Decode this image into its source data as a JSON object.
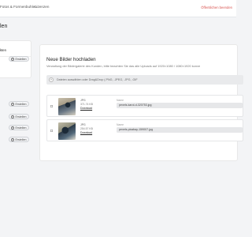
{
  "topbar": {
    "nav": [
      "Fotos & Formenbuhlen",
      "Lizenzen"
    ],
    "end_edit": "Öffentlichen beenden"
  },
  "page": {
    "title": "len"
  },
  "left_panel": {
    "heading": "kten",
    "buttons": [
      "Erstellen",
      "Erstellen",
      "Erstellen",
      "Erstellen",
      "Erstellen"
    ]
  },
  "main": {
    "title": "Neue Bilder hochladen",
    "subtitle": "Verwaltung der Bildergalerie des Kunden, bitte beachten Sie das alle Uploads auf 1920×1080 / 1080×1920 konve",
    "dropzone": {
      "icon": "plus-icon",
      "text": "Dateien auswählen oder Drag&Drop (.PNG, .JPEG, .JPG, .GIF"
    },
    "uploads": [
      {
        "type": "JPG",
        "size": "371.74 KB",
        "download": "Download",
        "name_label": "Name",
        "name_value": "pexels-karol-d-320753.jpg"
      },
      {
        "type": "JPG",
        "size": "254.57 KB",
        "download": "Download",
        "name_label": "Name",
        "name_value": "pexels-pixabay-159007.jpg"
      }
    ]
  }
}
